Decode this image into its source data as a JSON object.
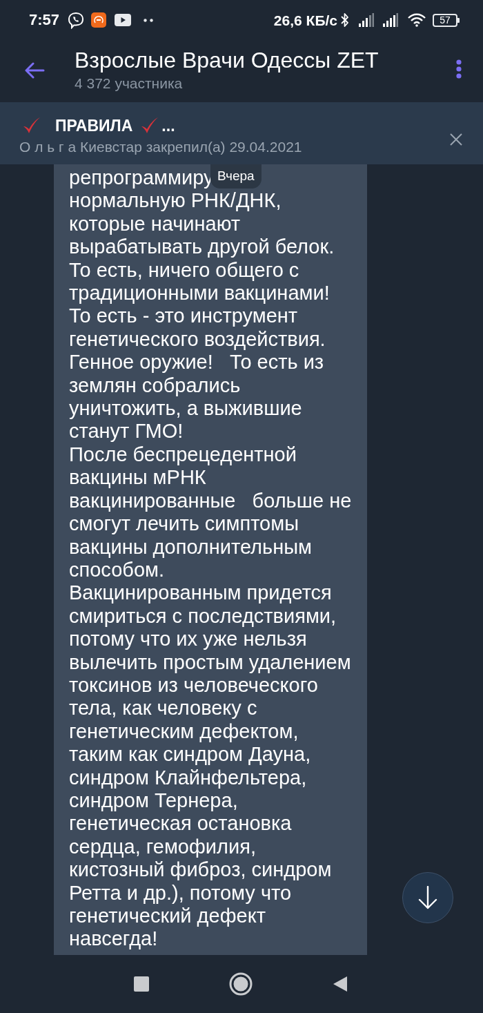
{
  "status_bar": {
    "time": "7:57",
    "speed": "26,6 КБ/с",
    "battery": "57"
  },
  "header": {
    "title": "Взрослые Врачи Одессы ZET",
    "subtitle": "4 372 участника"
  },
  "pinned": {
    "segments": [
      {
        "kind": "check"
      },
      {
        "kind": "text",
        "text": "ПРАВИЛА"
      },
      {
        "kind": "check"
      },
      {
        "kind": "text",
        "text": "..."
      }
    ],
    "subtitle": "О л ь г а Киевстар закрепил(а) 29.04.2021"
  },
  "date_badge": "Вчера",
  "message": {
    "lines": [
      "репрограммиру",
      "нормальную РНК/ДНК,",
      "которые начинают",
      "вырабатывать другой белок.",
      "То есть, ничего общего с",
      "традиционными вакцинами!",
      "То есть - это инструмент",
      "генетического воздействия.",
      "Генное оружие!   То есть из",
      "землян собрались",
      "уничтожить, а выжившие",
      "станут ГМО!",
      "После беспрецедентной",
      "вакцины мРНК",
      "вакцинированные   больше не",
      "смогут лечить симптомы",
      "вакцины дополнительным",
      "способом.",
      "Вакцинированным придется",
      "смириться с последствиями,",
      "потому что их уже нельзя",
      "вылечить простым удалением",
      "токсинов из человеческого",
      "тела, как человеку с",
      "генетическим дефектом,",
      "таким как синдром Дауна,",
      "синдром Клайнфельтера,",
      "синдром Тернера,",
      "генетическая остановка",
      "сердца, гемофилия,",
      "кистозный фиброз, синдром",
      "Ретта и др.), потому что",
      "генетический дефект",
      "навсегда!"
    ]
  }
}
